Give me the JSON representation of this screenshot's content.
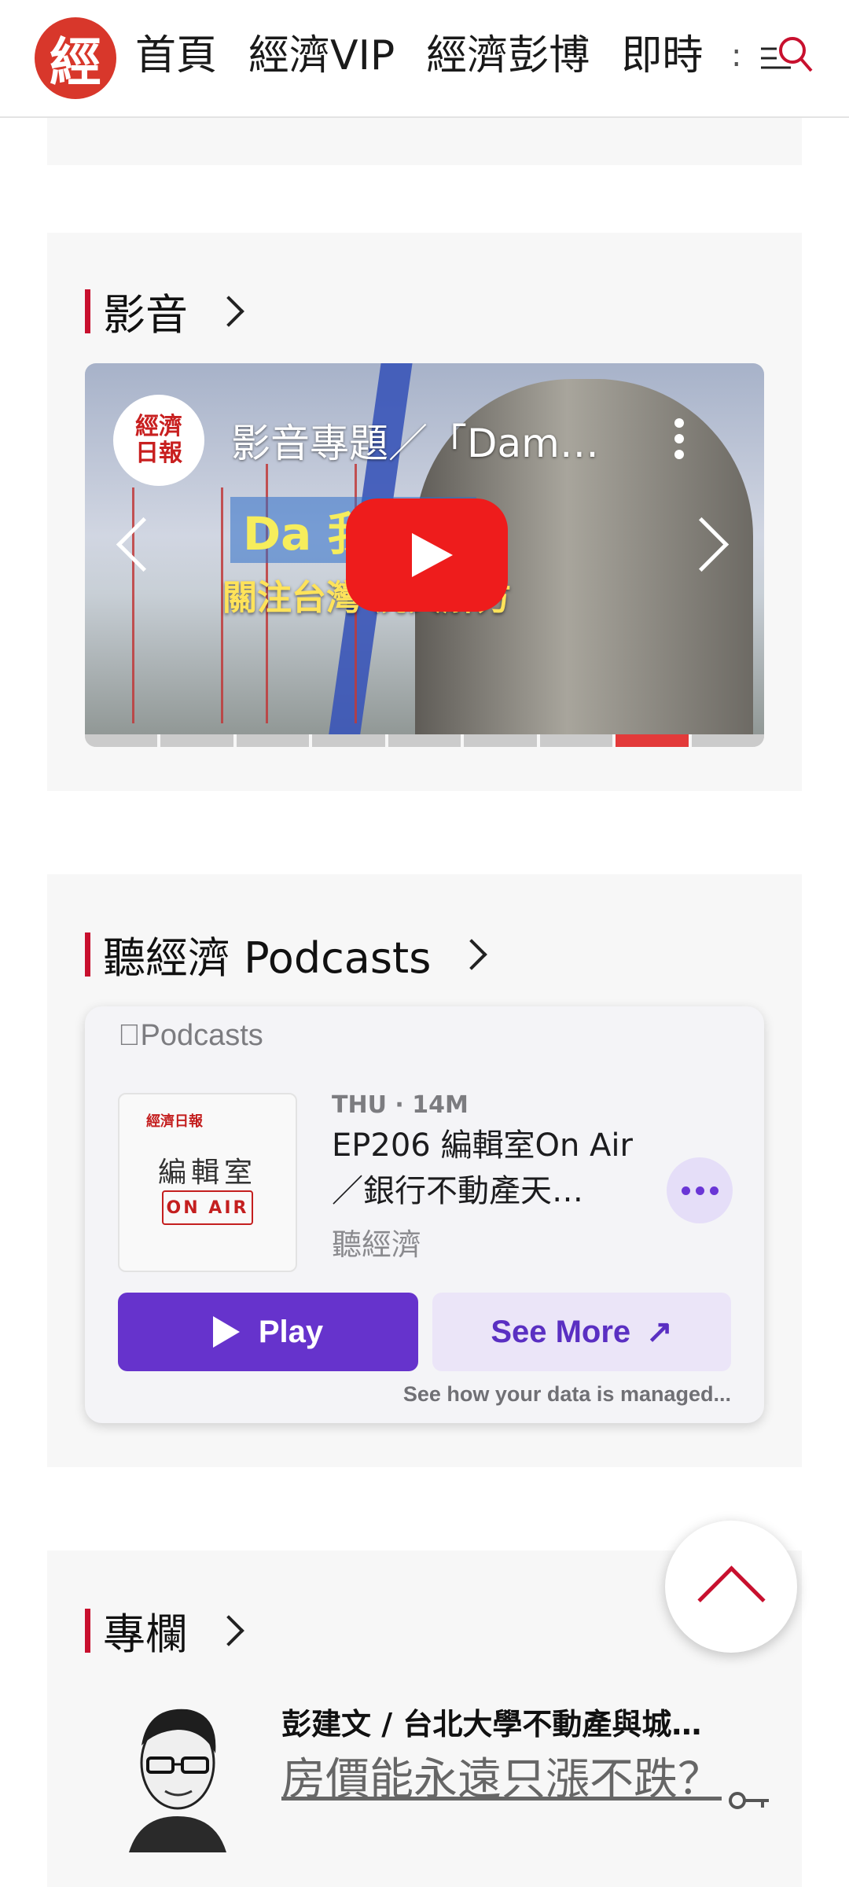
{
  "header": {
    "logo_char": "經",
    "nav": [
      "首頁",
      "經濟VIP",
      "經濟彭博",
      "即時"
    ],
    "more_dots": ":"
  },
  "video_section": {
    "title": "影音",
    "channel_logo": "經濟\n日報",
    "video_title": "影音專題／「Dam…",
    "banner_line1": "Da    我的電",
    "banner_line2": "關注台灣    況與解方",
    "progress_segments": 9,
    "active_segment": 8
  },
  "podcast_section": {
    "title": "聽經濟 Podcasts",
    "brand": "Podcasts",
    "art_top": "經濟日報",
    "art_mid": "編輯室",
    "art_badge": "ON AIR",
    "date": "THU · 14M",
    "episode": "EP206 編輯室On Air／銀行不動產天…",
    "show": "聽經濟",
    "play_label": "Play",
    "see_more_label": "See More",
    "data_note": "See how your data is managed..."
  },
  "column_section": {
    "title": "專欄",
    "author": "彭建文 / 台北大學不動產與城…",
    "article_title": "房價能永遠只漲不跌？"
  },
  "colors": {
    "accent_red": "#c8102e",
    "podcast_purple": "#6633cc"
  }
}
